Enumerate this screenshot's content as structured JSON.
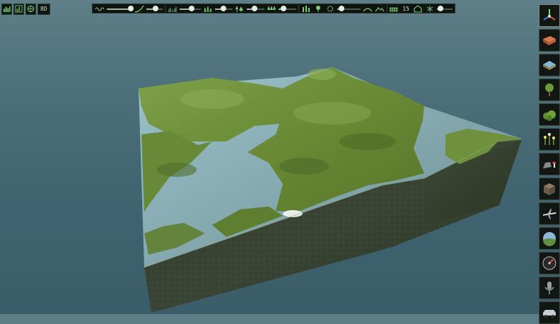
{
  "app": {
    "title": ""
  },
  "top_left": {
    "buttons": [
      {
        "icon": "terrain-grid-icon"
      },
      {
        "icon": "chart-bars-icon"
      },
      {
        "icon": "globe-icon"
      }
    ],
    "value": "8D"
  },
  "toolbar": {
    "sliders": [
      {
        "icon": "brush-noise-icon",
        "level": 0.95
      },
      {
        "icon": "brush-curve-icon",
        "level": 0.55
      },
      {
        "icon": "grass-small-icon",
        "level": 0.55
      },
      {
        "icon": "grass-medium-icon",
        "level": 0.45
      },
      {
        "icon": "tree-cluster-icon",
        "level": 0.45
      },
      {
        "icon": "tree-row-icon",
        "level": 0.3
      },
      {
        "icon": "foliage-dots-icon",
        "level": 0.2
      }
    ],
    "count_value": "15",
    "extra_icons": [
      "hill-icon",
      "mountain-icon",
      "fence-icon",
      "gear-icon"
    ]
  },
  "side_tools": [
    {
      "icon": "axis-gizmo-icon",
      "active": true
    },
    {
      "icon": "terrain-brick-icon"
    },
    {
      "icon": "water-tile-icon"
    },
    {
      "icon": "tree-icon"
    },
    {
      "icon": "bush-icon"
    },
    {
      "icon": "flowers-icon"
    },
    {
      "icon": "rock-mushroom-icon"
    },
    {
      "icon": "crate-icon"
    },
    {
      "icon": "airplane-icon"
    },
    {
      "icon": "sky-sphere-icon"
    },
    {
      "icon": "gauge-icon"
    },
    {
      "icon": "microphone-icon"
    },
    {
      "icon": "car-icon"
    }
  ],
  "colors": {
    "sky_top": "#5e7f87",
    "sky_bottom": "#3a5d69",
    "grass": "#6f8f3a",
    "grass_dark": "#4f6d2a",
    "water": "#7fa6b2",
    "soil": "#3a4232"
  }
}
